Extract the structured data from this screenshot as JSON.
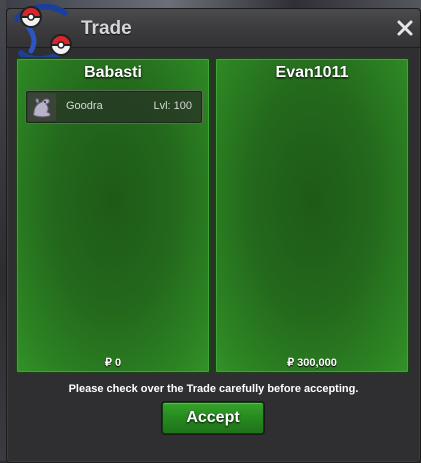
{
  "window": {
    "title": "Trade"
  },
  "trade": {
    "left": {
      "player": "Babasti",
      "items": [
        {
          "name": "Goodra",
          "level": "Lvl: 100",
          "icon": "goodra-sprite-icon"
        }
      ],
      "money": "₽ 0"
    },
    "right": {
      "player": "Evan1011",
      "items": [],
      "money": "₽ 300,000"
    }
  },
  "notice": "Please check over the Trade carefully before accepting.",
  "accept_label": "Accept",
  "colors": {
    "panel_green": "#23681c",
    "button_green": "#26891f",
    "window_dark": "#2f2f31"
  }
}
